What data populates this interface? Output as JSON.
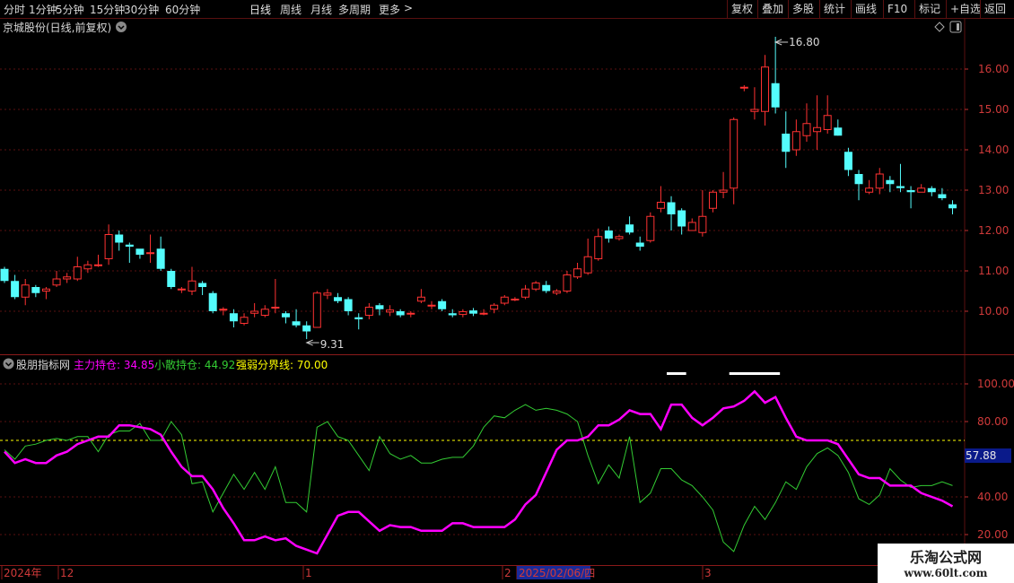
{
  "toolbar": {
    "periods": [
      "分时",
      "1分钟",
      "5分钟",
      "15分钟",
      "30分钟",
      "60分钟",
      "日线",
      "周线",
      "月线",
      "多周期",
      "更多"
    ],
    "more_arrow": ">",
    "active": "日线",
    "right_buttons": [
      "复权",
      "叠加",
      "多股",
      "统计",
      "画线",
      "F10",
      "标记",
      "+自选",
      "返回"
    ]
  },
  "main": {
    "title": "京城股份(日线,前复权)",
    "high_label": "16.80",
    "low_label": "9.31",
    "y_ticks": [
      "16.00",
      "15.00",
      "14.00",
      "13.00",
      "12.00",
      "11.00",
      "10.00"
    ]
  },
  "indicator": {
    "name": "股朋指标网",
    "main_label": "主力持仓: 34.85",
    "retail_label": "小散持仓: 44.92",
    "line_label": "强弱分界线: 70.00",
    "y_ticks": [
      "100.00",
      "80.00",
      "40.00",
      "20.00"
    ],
    "current_value": "57.88"
  },
  "date_axis": {
    "labels": [
      "2024年",
      "12",
      "1",
      "2",
      "2025/02/06/四",
      "3"
    ]
  },
  "watermark": {
    "title": "乐淘公式网",
    "url": "www.60lt.com"
  },
  "colors": {
    "up": "#ff3232",
    "down": "#54fcfc",
    "main_line": "#ff00ff",
    "retail_line": "#33cc33",
    "threshold": "#ffff00",
    "grid": "#5a1010",
    "bg": "#000000"
  },
  "chart_data": [
    {
      "type": "candlestick",
      "title": "京城股份(日线,前复权)",
      "ylim": [
        9.0,
        17.0
      ],
      "candles": [
        [
          11.05,
          10.75,
          11.1,
          10.7
        ],
        [
          10.75,
          10.35,
          10.9,
          10.3
        ],
        [
          10.35,
          10.65,
          10.8,
          10.15
        ],
        [
          10.6,
          10.45,
          10.65,
          10.35
        ],
        [
          10.5,
          10.55,
          10.6,
          10.3
        ],
        [
          10.65,
          10.8,
          11.0,
          10.6
        ],
        [
          10.8,
          10.85,
          10.95,
          10.7
        ],
        [
          10.8,
          11.1,
          11.35,
          10.75
        ],
        [
          11.05,
          11.15,
          11.25,
          10.95
        ],
        [
          11.15,
          11.15,
          11.4,
          11.1
        ],
        [
          11.3,
          11.9,
          12.15,
          11.15
        ],
        [
          11.9,
          11.7,
          12.0,
          11.5
        ],
        [
          11.65,
          11.6,
          11.7,
          11.2
        ],
        [
          11.55,
          11.4,
          11.5,
          11.3
        ],
        [
          11.45,
          11.45,
          11.9,
          11.2
        ],
        [
          11.55,
          11.05,
          11.85,
          11.0
        ],
        [
          11.0,
          10.6,
          11.05,
          10.55
        ],
        [
          10.55,
          10.55,
          10.6,
          10.45
        ],
        [
          10.5,
          10.75,
          11.1,
          10.4
        ],
        [
          10.7,
          10.6,
          10.75,
          10.4
        ],
        [
          10.45,
          10.0,
          10.5,
          9.95
        ],
        [
          10.05,
          10.05,
          10.1,
          9.9
        ],
        [
          9.95,
          9.75,
          10.05,
          9.6
        ],
        [
          9.7,
          9.85,
          9.95,
          9.65
        ],
        [
          9.95,
          10.0,
          10.2,
          9.85
        ],
        [
          9.9,
          10.05,
          10.15,
          9.85
        ],
        [
          10.1,
          10.1,
          10.8,
          9.95
        ],
        [
          9.95,
          9.85,
          10.0,
          9.7
        ],
        [
          9.75,
          9.65,
          10.05,
          9.6
        ],
        [
          9.65,
          9.5,
          9.75,
          9.31
        ],
        [
          9.6,
          10.45,
          10.5,
          9.6
        ],
        [
          10.4,
          10.45,
          10.55,
          10.3
        ],
        [
          10.35,
          10.25,
          10.45,
          10.2
        ],
        [
          10.3,
          10.0,
          10.35,
          9.9
        ],
        [
          9.85,
          9.8,
          9.95,
          9.55
        ],
        [
          9.9,
          10.1,
          10.2,
          9.8
        ],
        [
          10.15,
          10.05,
          10.2,
          9.9
        ],
        [
          9.98,
          10.03,
          10.15,
          9.88
        ],
        [
          10.0,
          9.9,
          10.05,
          9.85
        ],
        [
          9.95,
          9.95,
          10.0,
          9.85
        ],
        [
          10.25,
          10.35,
          10.55,
          10.2
        ],
        [
          10.15,
          10.15,
          10.25,
          10.05
        ],
        [
          10.25,
          10.05,
          10.3,
          10.0
        ],
        [
          9.95,
          9.9,
          10.05,
          9.85
        ],
        [
          9.92,
          9.99,
          10.05,
          9.85
        ],
        [
          10.02,
          9.94,
          10.08,
          9.88
        ],
        [
          9.95,
          9.95,
          10.05,
          9.9
        ],
        [
          10.05,
          10.15,
          10.2,
          9.95
        ],
        [
          10.2,
          10.35,
          10.4,
          10.15
        ],
        [
          10.3,
          10.3,
          10.35,
          10.25
        ],
        [
          10.35,
          10.55,
          10.65,
          10.3
        ],
        [
          10.55,
          10.7,
          10.75,
          10.5
        ],
        [
          10.65,
          10.5,
          10.75,
          10.45
        ],
        [
          10.45,
          10.5,
          10.55,
          10.4
        ],
        [
          10.5,
          10.9,
          11.0,
          10.45
        ],
        [
          10.85,
          11.05,
          11.2,
          10.8
        ],
        [
          10.95,
          11.35,
          11.8,
          10.9
        ],
        [
          11.3,
          11.85,
          12.05,
          11.25
        ],
        [
          12.0,
          11.8,
          12.1,
          11.7
        ],
        [
          11.8,
          11.85,
          11.9,
          11.75
        ],
        [
          12.15,
          11.95,
          12.35,
          11.9
        ],
        [
          11.7,
          11.6,
          11.85,
          11.5
        ],
        [
          11.75,
          12.35,
          12.45,
          11.7
        ],
        [
          12.55,
          12.7,
          13.1,
          12.45
        ],
        [
          12.7,
          12.4,
          12.85,
          12.0
        ],
        [
          12.5,
          12.1,
          12.55,
          11.9
        ],
        [
          12.0,
          12.2,
          12.3,
          12.0
        ],
        [
          11.95,
          12.35,
          13.0,
          11.85
        ],
        [
          12.55,
          12.95,
          13.0,
          12.45
        ],
        [
          12.95,
          13.0,
          13.45,
          12.8
        ],
        [
          13.05,
          14.75,
          14.8,
          12.65
        ],
        [
          15.55,
          15.55,
          15.6,
          15.45
        ],
        [
          14.95,
          15.0,
          15.55,
          14.75
        ],
        [
          14.95,
          16.05,
          16.35,
          14.6
        ],
        [
          15.65,
          15.05,
          16.8,
          14.9
        ],
        [
          14.4,
          13.95,
          14.95,
          13.55
        ],
        [
          14.0,
          14.45,
          14.75,
          13.85
        ],
        [
          14.35,
          14.65,
          15.15,
          14.2
        ],
        [
          14.45,
          14.55,
          15.35,
          14.0
        ],
        [
          14.5,
          14.85,
          15.35,
          14.4
        ],
        [
          14.55,
          14.35,
          14.75,
          14.35
        ],
        [
          13.95,
          13.5,
          14.05,
          13.35
        ],
        [
          13.4,
          13.15,
          13.5,
          12.75
        ],
        [
          12.95,
          13.05,
          13.25,
          12.9
        ],
        [
          13.05,
          13.4,
          13.55,
          12.9
        ],
        [
          13.25,
          13.15,
          13.35,
          12.95
        ],
        [
          13.1,
          13.05,
          13.65,
          12.95
        ],
        [
          13.0,
          12.95,
          13.1,
          12.55
        ],
        [
          12.95,
          13.05,
          13.15,
          12.95
        ],
        [
          13.05,
          12.95,
          13.1,
          12.85
        ],
        [
          12.9,
          12.8,
          13.05,
          12.75
        ],
        [
          12.65,
          12.55,
          12.75,
          12.4
        ]
      ]
    },
    {
      "type": "line",
      "title": "股朋指标网",
      "ylim": [
        10,
        110
      ],
      "threshold": 70.0,
      "series": [
        {
          "name": "主力持仓",
          "values": [
            64,
            58,
            60,
            58,
            58,
            62,
            64,
            68,
            70,
            72,
            72,
            78,
            78,
            77,
            76,
            73,
            64,
            56,
            51,
            51,
            44,
            34,
            26,
            17,
            17,
            19,
            17,
            18,
            14,
            12,
            10,
            20,
            30,
            32,
            32,
            27,
            22,
            25,
            24,
            24,
            22,
            22,
            22,
            26,
            26,
            24,
            24,
            24,
            24,
            28,
            36,
            41,
            53,
            65,
            70,
            70,
            72,
            78,
            78,
            81,
            86,
            84,
            84,
            76,
            89,
            89,
            82,
            78,
            82,
            87,
            88,
            91,
            96,
            90,
            93,
            82,
            72,
            70,
            70,
            70,
            68,
            60,
            52,
            50,
            50,
            46,
            46,
            46,
            42,
            40,
            38,
            35
          ]
        },
        {
          "name": "小散持仓",
          "values": [
            65,
            60,
            67,
            68,
            70,
            71,
            70,
            72,
            72,
            64,
            73,
            75,
            75,
            79,
            70,
            70,
            80,
            73,
            47,
            48,
            32,
            42,
            52,
            44,
            53,
            44,
            56,
            37,
            37,
            32,
            77,
            80,
            72,
            70,
            62,
            54,
            72,
            63,
            60,
            62,
            58,
            58,
            60,
            61,
            61,
            67,
            77,
            83,
            82,
            86,
            89,
            86,
            87,
            86,
            84,
            80,
            62,
            47,
            57,
            50,
            72,
            37,
            42,
            55,
            55,
            49,
            46,
            40,
            33,
            16,
            11,
            25,
            35,
            28,
            37,
            48,
            44,
            56,
            63,
            66,
            62,
            53,
            39,
            36,
            41,
            55,
            49,
            45,
            46,
            46,
            48,
            46
          ]
        }
      ]
    }
  ]
}
